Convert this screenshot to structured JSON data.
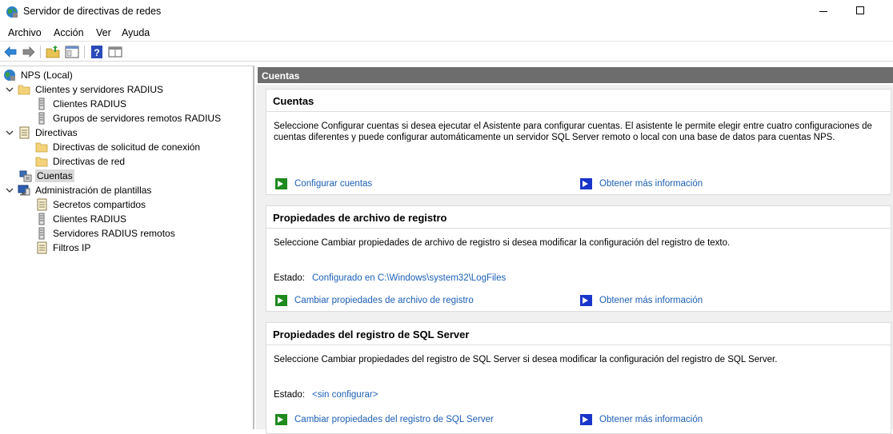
{
  "window": {
    "title": "Servidor de directivas de redes"
  },
  "menu": [
    "Archivo",
    "Acción",
    "Ver",
    "Ayuda"
  ],
  "tree": {
    "root": "NPS (Local)",
    "radius_group": "Clientes y servidores RADIUS",
    "radius_clients": "Clientes RADIUS",
    "remote_groups": "Grupos de servidores remotos RADIUS",
    "policies": "Directivas",
    "conn_policies": "Directivas de solicitud de conexión",
    "net_policies": "Directivas de red",
    "accounting": "Cuentas",
    "templates": "Administración de plantillas",
    "shared_secrets": "Secretos compartidos",
    "tpl_clients": "Clientes RADIUS",
    "tpl_servers": "Servidores RADIUS remotos",
    "ip_filters": "Filtros IP"
  },
  "content": {
    "header": "Cuentas",
    "sections": [
      {
        "title": "Cuentas",
        "desc": "Seleccione Configurar cuentas si desea ejecutar el Asistente para configurar cuentas. El asistente le permite elegir entre cuatro configuraciones de cuentas diferentes y puede configurar automáticamente un servidor SQL Server remoto o local con una base de datos para cuentas NPS.",
        "action": "Configurar cuentas",
        "more": "Obtener más información"
      },
      {
        "title": "Propiedades de archivo de registro",
        "desc": "Seleccione Cambiar propiedades de archivo de registro si desea modificar la configuración del registro de texto.",
        "status_label": "Estado:",
        "status_value": "Configurado en C:\\Windows\\system32\\LogFiles",
        "action": "Cambiar propiedades de archivo de registro",
        "more": "Obtener más información"
      },
      {
        "title": "Propiedades del registro de SQL Server",
        "desc": "Seleccione Cambiar propiedades del registro de SQL Server si desea modificar la configuración del registro de SQL Server.",
        "status_label": "Estado:",
        "status_value": "<sin configurar>",
        "action": "Cambiar propiedades del registro de SQL Server",
        "more": "Obtener más información"
      }
    ]
  }
}
